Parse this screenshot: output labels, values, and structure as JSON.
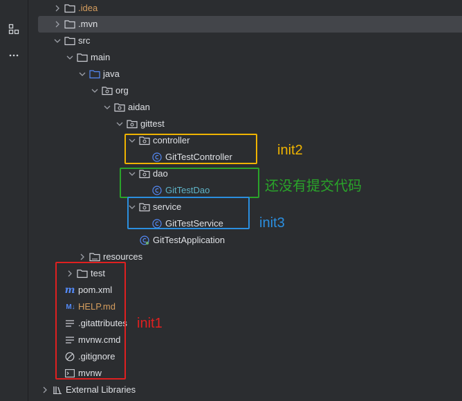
{
  "colors": {
    "bg": "#2b2d30",
    "selected": "#43454a",
    "text": "#dfe1e5",
    "yellow_box": "#f0b400",
    "green_box": "#2aa42a",
    "blue_box": "#2b8fe0",
    "red_box": "#e02020"
  },
  "sidebar": {
    "icons": [
      "structure-icon",
      "more-icon"
    ]
  },
  "tree": {
    "idea": ".idea",
    "mvn": ".mvn",
    "src": "src",
    "main": "main",
    "java": "java",
    "org": "org",
    "aidan": "aidan",
    "gittest": "gittest",
    "controller": "controller",
    "git_test_controller": "GitTestController",
    "dao": "dao",
    "git_test_dao": "GitTestDao",
    "service": "service",
    "git_test_service": "GitTestService",
    "git_test_application": "GitTestApplication",
    "resources": "resources",
    "test": "test",
    "pom": "pom.xml",
    "help": "HELP.md",
    "gitattributes": ".gitattributes",
    "mvnw_cmd": "mvnw.cmd",
    "gitignore": ".gitignore",
    "mvnw": "mvnw",
    "external_libraries": "External Libraries"
  },
  "annotations": {
    "init2": "init2",
    "not_committed": "还没有提交代码",
    "init3": "init3",
    "init1": "init1"
  }
}
